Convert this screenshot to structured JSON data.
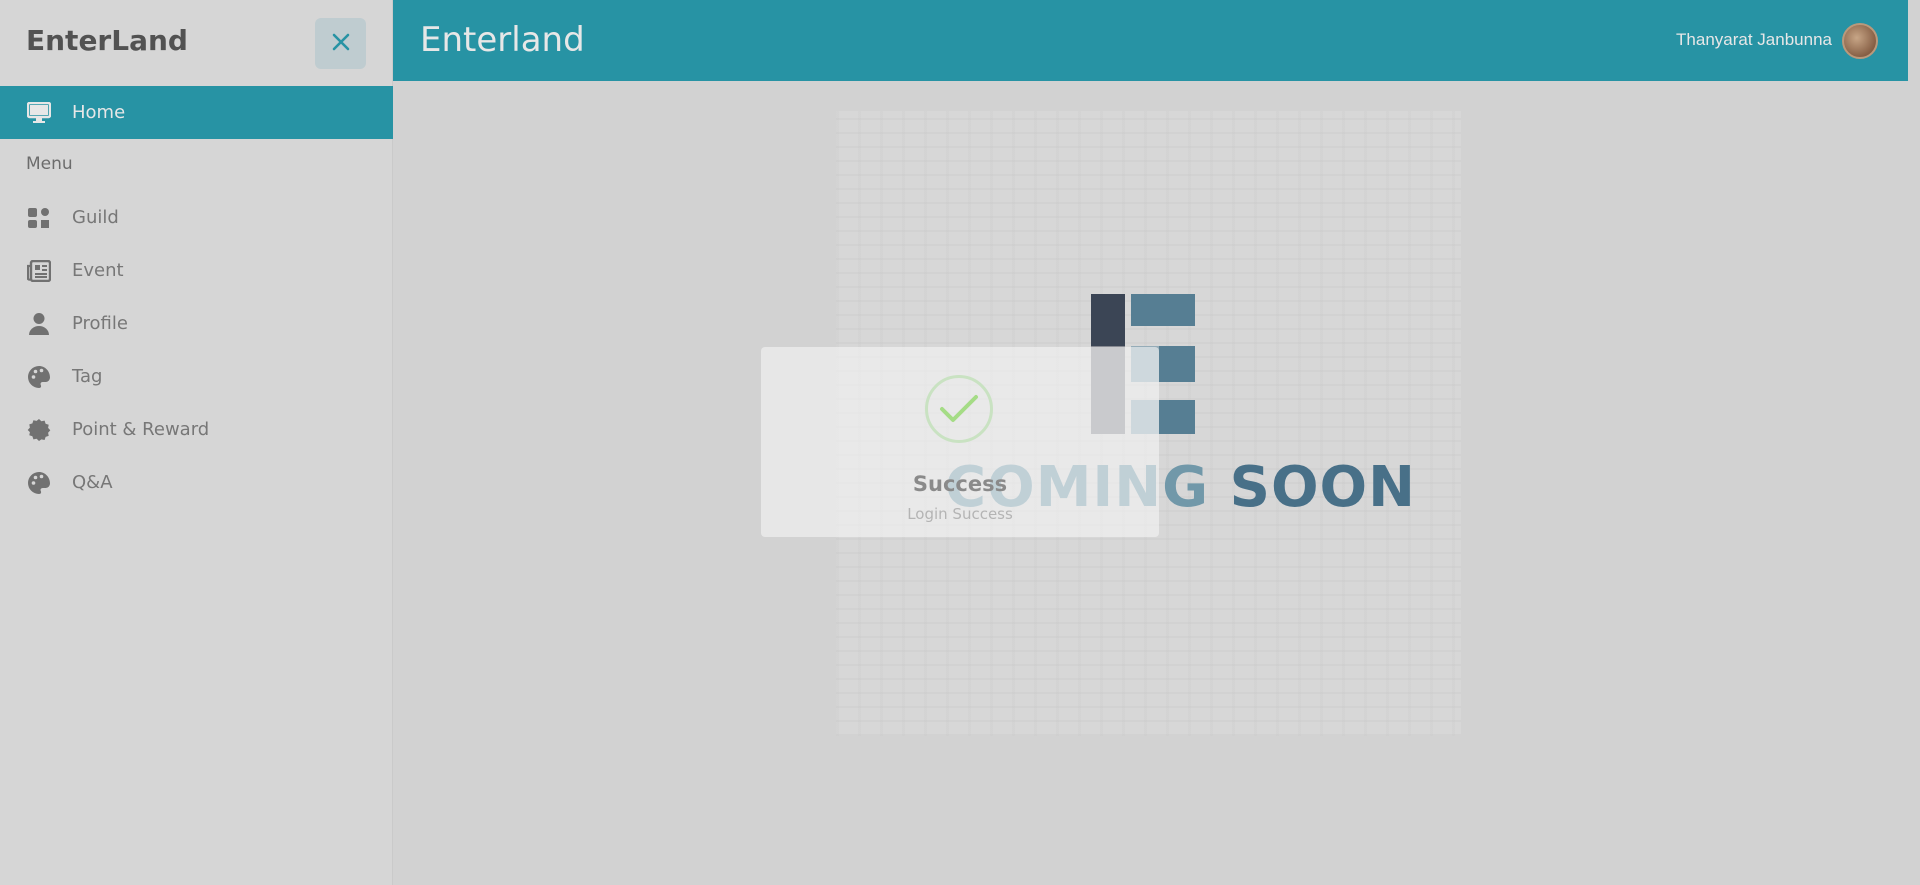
{
  "sidebar": {
    "brand": "EnterLand",
    "home_label": "Home",
    "menu_label": "Menu",
    "items": [
      {
        "label": "Guild",
        "icon": "guild-icon"
      },
      {
        "label": "Event",
        "icon": "newspaper-icon"
      },
      {
        "label": "Profile",
        "icon": "user-icon"
      },
      {
        "label": "Tag",
        "icon": "palette-icon"
      },
      {
        "label": "Point & Reward",
        "icon": "badge-icon"
      },
      {
        "label": "Q&A",
        "icon": "palette-icon"
      }
    ]
  },
  "topbar": {
    "title": "Enterland",
    "user_name": "Thanyarat Janbunna"
  },
  "poster": {
    "word1": "COMING",
    "word2": "SOON"
  },
  "modal": {
    "title": "Success",
    "text": "Login Success"
  },
  "colors": {
    "accent": "#1599ae",
    "sidebar_bg": "#ebebeb",
    "success": "#a5dc86"
  }
}
